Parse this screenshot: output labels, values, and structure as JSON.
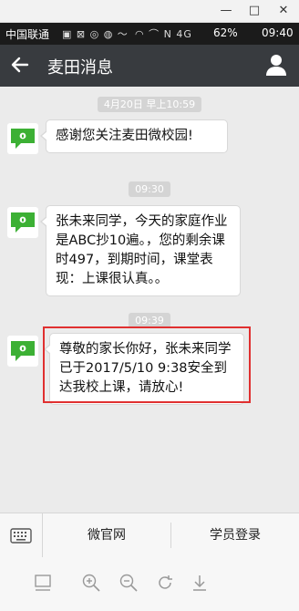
{
  "window_controls": {
    "minimize": "—",
    "maximize": "□",
    "close": "✕"
  },
  "status_bar": {
    "carrier": "中国联通",
    "left_icons": "▣ ⊠ ◎ ◍ 〜",
    "right_icons": "◠ ⌒ N 4G",
    "battery": "62%",
    "time": "09:40"
  },
  "app_bar": {
    "title": "麦田消息"
  },
  "messages": [
    {
      "time": "4月20日 早上10:59",
      "text": "感谢您关注麦田微校园!"
    },
    {
      "time": "09:30",
      "text": "张未来同学，今天的家庭作业是ABC抄10遍。，您的剩余课时497，到期时间，课堂表现：上课很认真。。"
    },
    {
      "time": "09:39",
      "text": "尊敬的家长你好，张未来同学已于2017/5/10 9:38安全到达我校上课，请放心!"
    }
  ],
  "menu": {
    "item1": "微官网",
    "item2": "学员登录"
  },
  "toolbar_icons": [
    "layout-icon",
    "zoom-in-icon",
    "zoom-out-icon",
    "refresh-icon",
    "download-icon"
  ],
  "colors": {
    "app_bar": "#383b3f",
    "highlight": "#e03030",
    "avatar_green": "#3cb034"
  }
}
